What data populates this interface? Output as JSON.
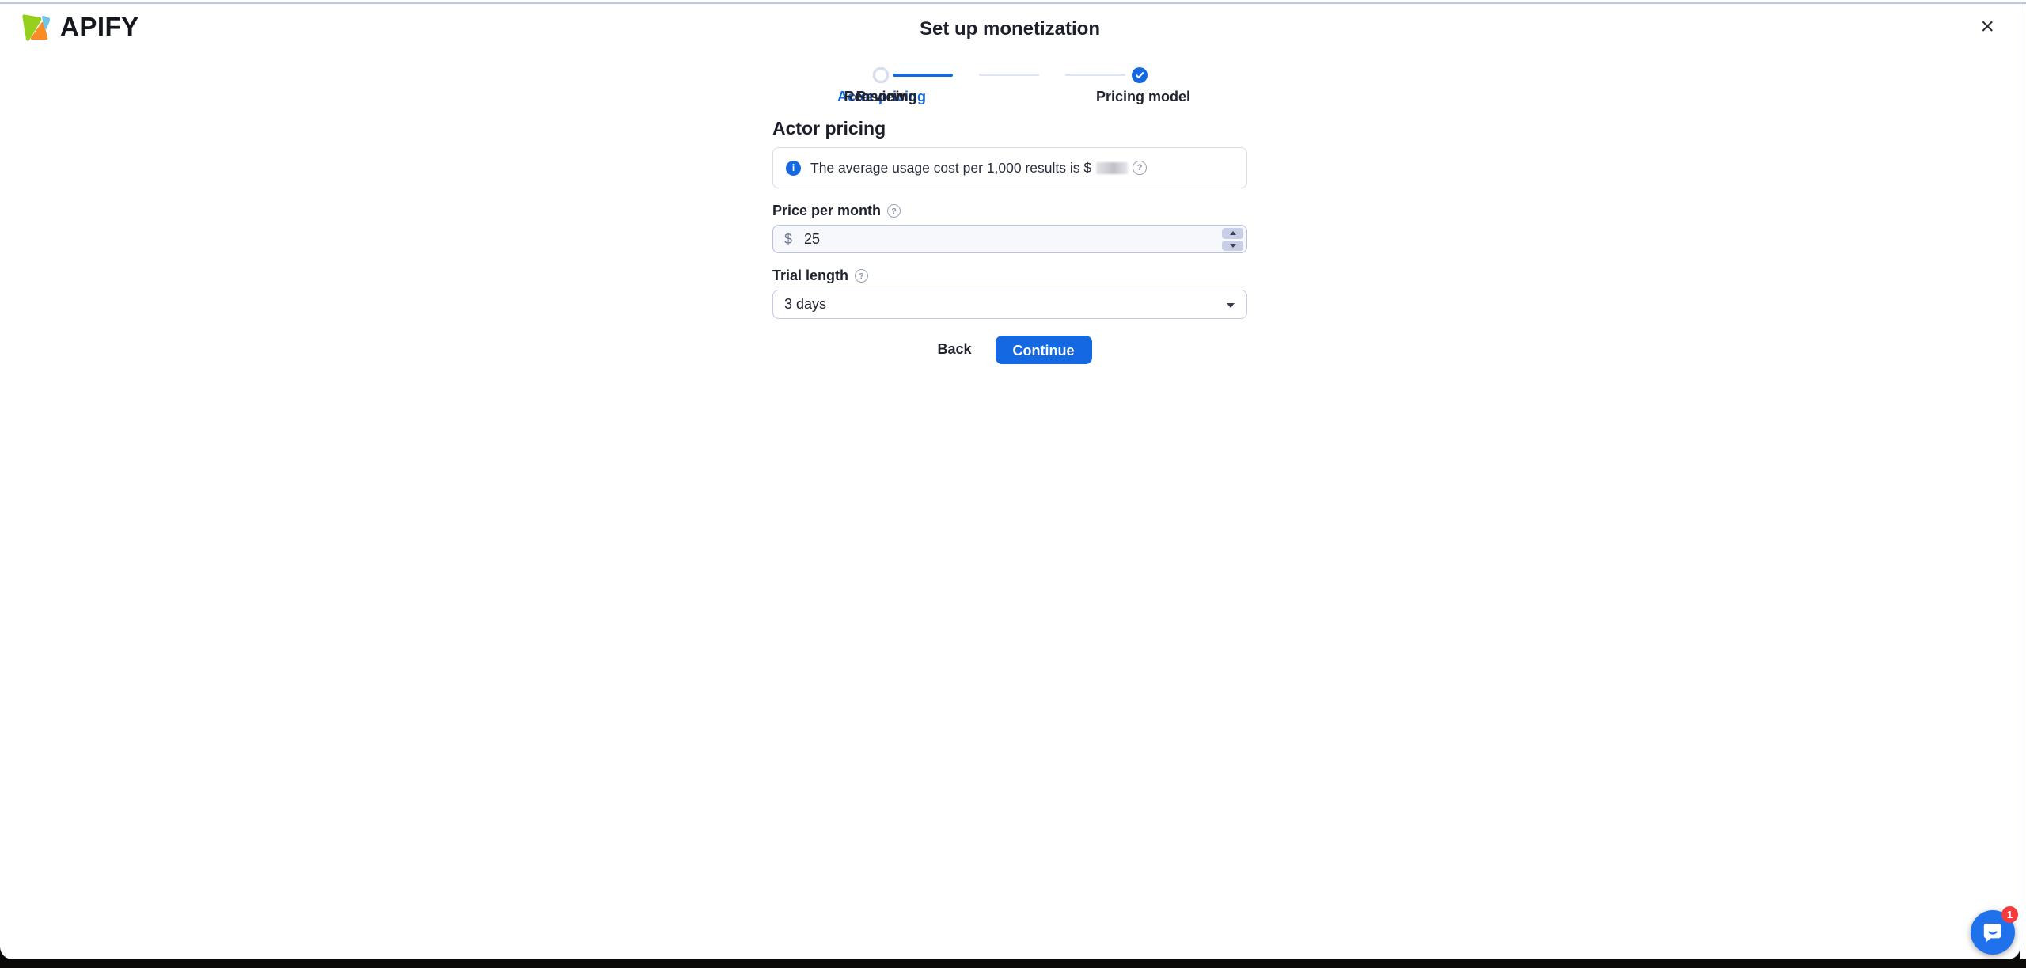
{
  "header": {
    "brand": "APIFY",
    "title": "Set up monetization",
    "close_icon": "×"
  },
  "stepper": {
    "steps": [
      {
        "label": "Pricing model",
        "state": "completed"
      },
      {
        "label": "Actor pricing",
        "state": "current"
      },
      {
        "label": "Reasoning",
        "state": "upcoming"
      },
      {
        "label": "Review",
        "state": "upcoming"
      }
    ]
  },
  "main": {
    "heading": "Actor pricing",
    "info_banner": {
      "icon": "i",
      "text_before": "The average usage cost per 1,000 results is $",
      "value_redacted": true,
      "help_icon": "?"
    },
    "price_field": {
      "label": "Price per month",
      "help_icon": "?",
      "currency_prefix": "$",
      "value": "25"
    },
    "trial_field": {
      "label": "Trial length",
      "help_icon": "?",
      "value": "3 days"
    },
    "actions": {
      "back_label": "Back",
      "continue_label": "Continue"
    }
  },
  "chat": {
    "badge_count": "1"
  },
  "colors": {
    "accent_blue": "#1468e2",
    "launcher_blue": "#1f72ec",
    "badge_red": "#f53b3b",
    "logo_green": "#97d01c",
    "logo_orange": "#fb8b23",
    "logo_blue": "#71c5e8",
    "connector_gray": "#e0e4ef",
    "input_bg": "#f6f8fc"
  }
}
